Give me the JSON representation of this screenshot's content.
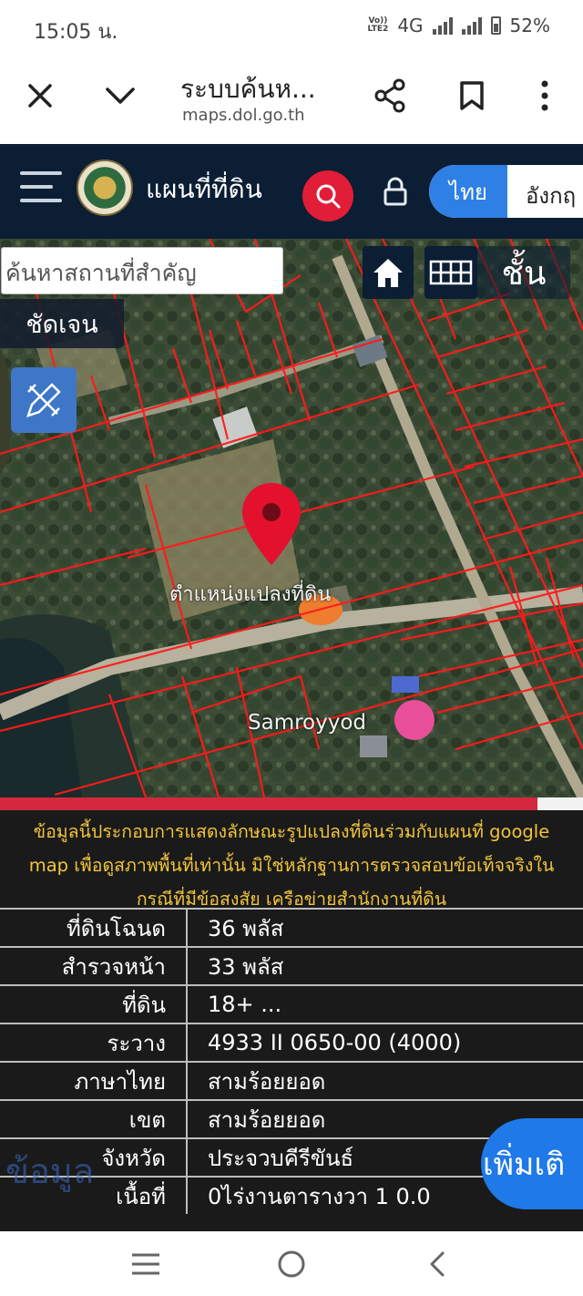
{
  "status": {
    "time": "15:05 น.",
    "volte": "Vo)) LTE2",
    "network": "4G",
    "battery": "52%"
  },
  "browser": {
    "title": "ระบบค้นห...",
    "url": "maps.dol.go.th",
    "icons": [
      "close-icon",
      "chevron-down-icon",
      "share-icon",
      "bookmark-icon",
      "more-vert-icon"
    ]
  },
  "site": {
    "brand": "แผนที่ที่ดิน",
    "lang_active": "ไทย",
    "lang_other": "อังกฤ",
    "colors": {
      "header": "#0b1e34",
      "search_button": "#e11d38",
      "lang_active": "#2f80e4"
    }
  },
  "map": {
    "search_placeholder": "ค้นหาสถานที่สำคัญ",
    "clear_label": "ชัดเจน",
    "layers_label": "ชั้น",
    "pin_label": "ตำแหน่งแปลงที่ดิน",
    "place_label": "Samroyyod",
    "colors": {
      "parcel_lines": "#ff1a1a",
      "pin": "#e3102e"
    }
  },
  "info": {
    "disclaimer": "ข้อมูลนี้ประกอบการแสดงลักษณะรูปแปลงที่ดินร่วมกับแผนที่ google map เพื่อดูสภาพพื้นที่เท่านั้น มิใช่หลักฐานการตรวจสอบข้อเท็จจริงในกรณีที่มีข้อสงสัย เครือข่ายสำนักงานที่ดิน",
    "rows": [
      {
        "label": "ที่ดินโฉนด",
        "value": "36 พลัส"
      },
      {
        "label": "สำรวจหน้า",
        "value": "33 พลัส"
      },
      {
        "label": "ที่ดิน",
        "value": "18+ ..."
      },
      {
        "label": "ระวาง",
        "value": "4933 II 0650-00 (4000)"
      },
      {
        "label": "ภาษาไทย",
        "value": "สามร้อยยอด"
      },
      {
        "label": "เขต",
        "value": "สามร้อยยอด"
      },
      {
        "label": "จังหวัด",
        "value": "ประจวบคีรีขันธ์"
      },
      {
        "label": "เนื้อที่",
        "value": "0ไร่งานตารางวา 1 0.0"
      }
    ],
    "more_button": "เพิ่มเติ",
    "faded_button": "ข้อมูล",
    "colors": {
      "disclaimer": "#f2c53d",
      "panel": "#1a1a1a",
      "more_button": "#1f79e8"
    }
  },
  "nav": {
    "icons": [
      "recent-apps-icon",
      "home-circle-icon",
      "back-icon"
    ]
  }
}
